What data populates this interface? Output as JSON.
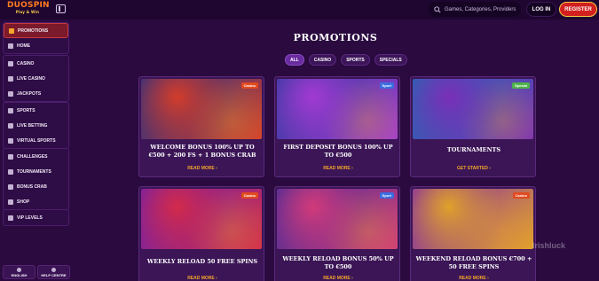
{
  "header": {
    "logo_text": "DUOSPIN",
    "logo_tagline": "Play & Win",
    "search_placeholder": "Games, Categories, Providers",
    "login_label": "LOG IN",
    "register_label": "REGISTER"
  },
  "sidebar": {
    "groups": [
      {
        "items": [
          {
            "label": "Promotions",
            "icon": "gift-icon",
            "active": true
          },
          {
            "label": "Home",
            "icon": "home-icon"
          }
        ]
      },
      {
        "items": [
          {
            "label": "Casino",
            "icon": "casino-icon"
          },
          {
            "label": "Live Casino",
            "icon": "live-casino-icon"
          },
          {
            "label": "Jackpots",
            "icon": "jackpot-icon"
          }
        ]
      },
      {
        "items": [
          {
            "label": "Sports",
            "icon": "sports-icon"
          },
          {
            "label": "Live Betting",
            "icon": "live-betting-icon"
          },
          {
            "label": "Virtual Sports",
            "icon": "virtual-sports-icon"
          }
        ]
      },
      {
        "items": [
          {
            "label": "Challenges",
            "icon": "challenges-icon"
          },
          {
            "label": "Tournaments",
            "icon": "tournaments-icon"
          },
          {
            "label": "Bonus Crab",
            "icon": "bonus-crab-icon"
          },
          {
            "label": "Shop",
            "icon": "shop-icon"
          }
        ]
      },
      {
        "items": [
          {
            "label": "VIP Levels",
            "icon": "vip-icon"
          }
        ]
      }
    ],
    "bottom": [
      {
        "label": "ENGLISH",
        "icon": "globe-icon"
      },
      {
        "label": "HELP CENTRE",
        "icon": "help-icon"
      }
    ]
  },
  "main": {
    "title": "PROMOTIONS",
    "filters": [
      {
        "label": "ALL",
        "active": true
      },
      {
        "label": "CASINO"
      },
      {
        "label": "SPORTS"
      },
      {
        "label": "SPECIALS"
      }
    ],
    "cards": [
      {
        "badge": "Casino",
        "badge_color": "#e04a1f",
        "title": "WELCOME BONUS 100% UP TO €500 + 200 FS + 1 BONUS CRAB",
        "cta": "READ MORE",
        "art_colors": [
          "#1a2f8a",
          "#d23c2a"
        ]
      },
      {
        "badge": "Sport",
        "badge_color": "#3a6de0",
        "title": "FIRST DEPOSIT BONUS 100% UP TO €500",
        "cta": "READ MORE",
        "art_colors": [
          "#2a3b9a",
          "#a23ad2"
        ]
      },
      {
        "badge": "Special",
        "badge_color": "#4db24a",
        "title": "TOURNAMENTS",
        "cta": "GET STARTED",
        "art_colors": [
          "#1f6ab0",
          "#7a2fb8"
        ]
      },
      {
        "badge": "Casino",
        "badge_color": "#e04a1f",
        "title": "WEEKLY RELOAD 50 FREE SPINS",
        "cta": "READ MORE",
        "art_colors": [
          "#6a1fb0",
          "#d22a4a"
        ]
      },
      {
        "badge": "Sport",
        "badge_color": "#3a6de0",
        "title": "WEEKLY RELOAD BONUS 50% UP TO €500",
        "cta": "READ MORE",
        "art_colors": [
          "#3a2a9a",
          "#d23a7a"
        ]
      },
      {
        "badge": "Casino",
        "badge_color": "#e04a1f",
        "title": "WEEKEND RELOAD BONUS €700 + 50 FREE SPINS",
        "cta": "READ MORE",
        "art_colors": [
          "#7a1fb0",
          "#e0a12a"
        ]
      }
    ]
  },
  "watermark": "Irishluck"
}
